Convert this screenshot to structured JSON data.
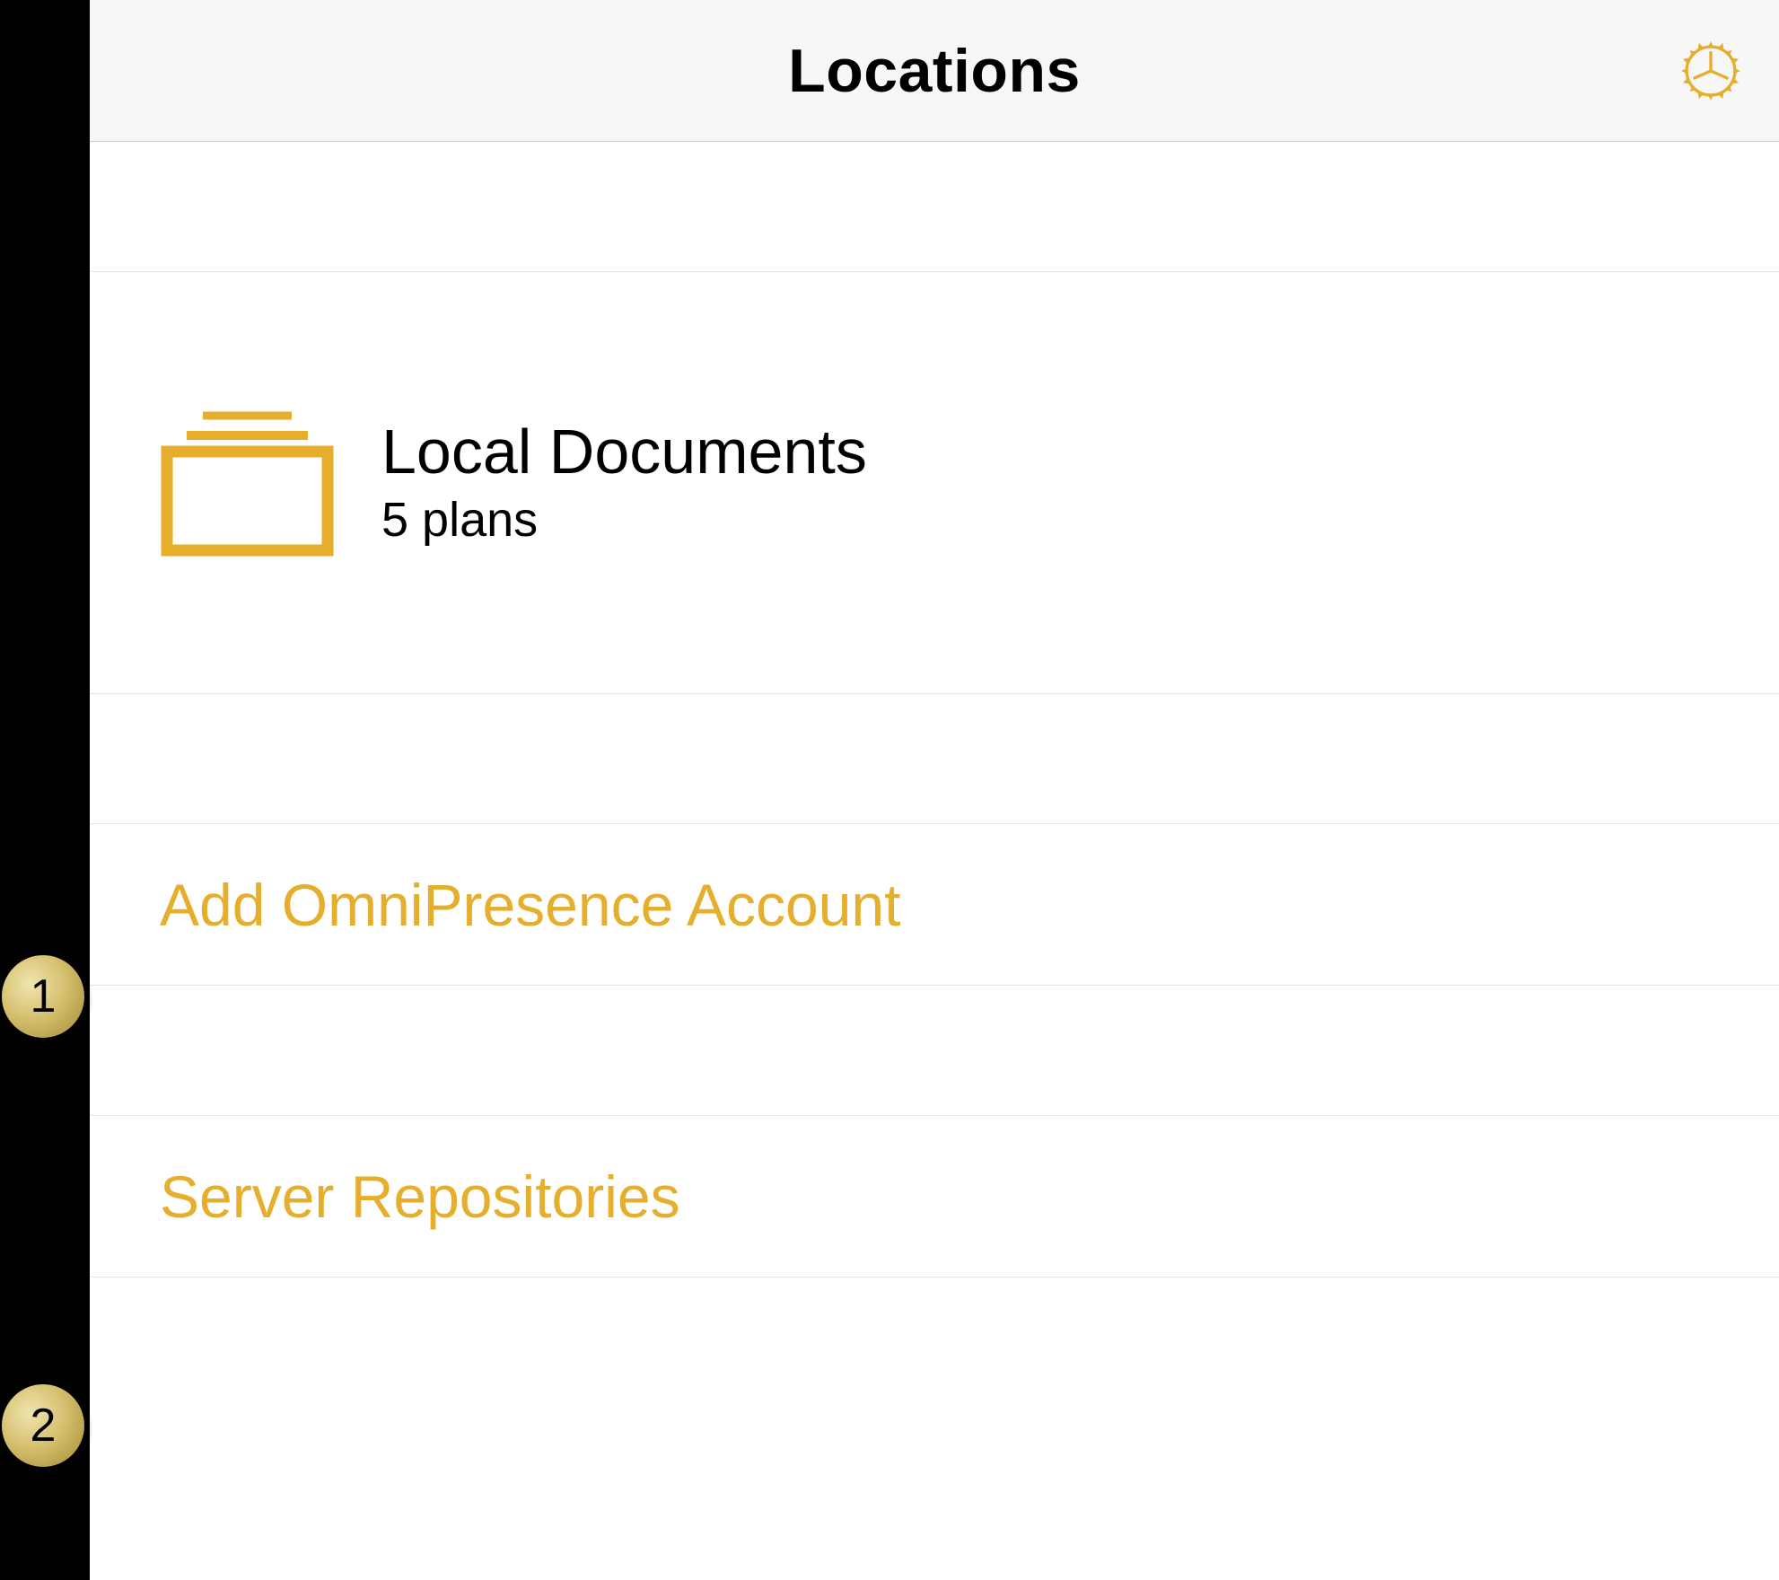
{
  "header": {
    "title": "Locations"
  },
  "localDocuments": {
    "title": "Local Documents",
    "subtitle": "5 plans"
  },
  "actions": {
    "addOmniPresence": "Add OmniPresence Account",
    "serverRepositories": "Server Repositories"
  },
  "callouts": {
    "one": "1",
    "two": "2"
  },
  "colors": {
    "accent": "#e5ae2d"
  }
}
